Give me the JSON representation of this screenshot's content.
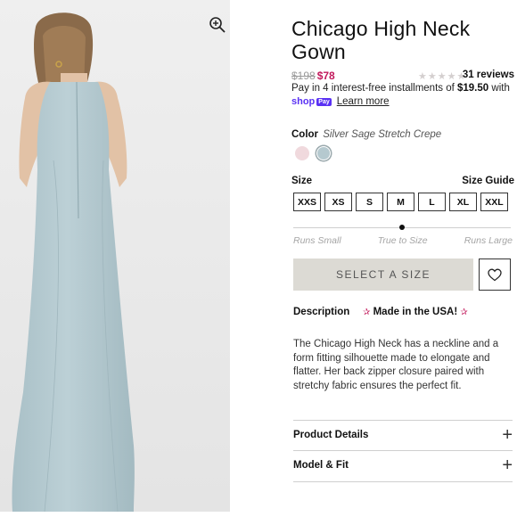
{
  "product": {
    "title": "Chicago High Neck Gown",
    "price_original": "$198",
    "price_sale": "$78",
    "stars": "★★★★★",
    "reviews": "31 reviews",
    "pay_prefix": "Pay in 4 interest-free installments of ",
    "pay_amount": "$19.50",
    "pay_suffix": " with",
    "shop_logo": "shop",
    "shop_pay_badge": "Pay",
    "learn_more": "Learn more"
  },
  "color": {
    "label": "Color",
    "value": "Silver Sage Stretch Crepe",
    "swatches": [
      "#f0d9dd",
      "#b5c9cf"
    ]
  },
  "size": {
    "label": "Size",
    "guide": "Size Guide",
    "options": [
      "XXS",
      "XS",
      "S",
      "M",
      "L",
      "XL",
      "XXL"
    ],
    "fit_labels": [
      "Runs Small",
      "True to Size",
      "Runs Large"
    ]
  },
  "actions": {
    "select_size": "SELECT A SIZE"
  },
  "description": {
    "label": "Description",
    "made_in": "Made in the USA!",
    "text": "The Chicago High Neck has a neckline and a form fitting silhouette made to elongate and flatter. Her back zipper closure paired with stretchy fabric ensures the perfect fit."
  },
  "accordions": [
    "Product Details",
    "Model & Fit"
  ],
  "colors": {
    "sale": "#c2185b",
    "gown": "#b9cdd3",
    "button_bg": "#dcdad4",
    "shop_pay": "#5a31f4"
  }
}
